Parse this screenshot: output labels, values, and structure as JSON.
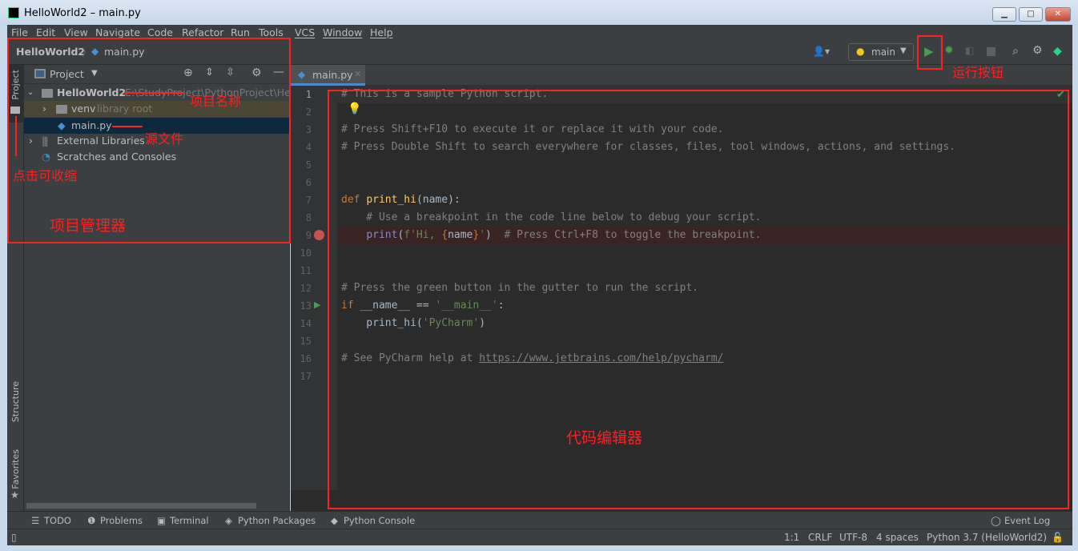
{
  "window": {
    "title": "HelloWorld2 – main.py",
    "min": "▁",
    "max": "□",
    "close": "✕"
  },
  "menu": [
    "File",
    "Edit",
    "View",
    "Navigate",
    "Code",
    "Refactor",
    "Run",
    "Tools",
    "VCS",
    "Window",
    "Help"
  ],
  "breadcrumb": {
    "project": "HelloWorld2",
    "file": "main.py"
  },
  "run_config": "main",
  "left_strip": {
    "project": "Project",
    "structure": "Structure",
    "favorites": "Favorites"
  },
  "project_panel": {
    "title": "Project",
    "tree": [
      {
        "label": "HelloWorld2",
        "hint": "E:\\StudyProject\\PythonProject\\Hello",
        "expanded": true,
        "bold": true
      },
      {
        "label": "venv",
        "hint": "library root"
      },
      {
        "label": "main.py",
        "selected": true
      },
      {
        "label": "External Libraries"
      },
      {
        "label": "Scratches and Consoles"
      }
    ]
  },
  "editor": {
    "tab": "main.py",
    "lines": [
      [
        {
          "t": "# This is a sample Python script.",
          "c": "#808080"
        }
      ],
      [],
      [
        {
          "t": "# Press Shift+F10 to execute it or replace it with your code.",
          "c": "#808080"
        }
      ],
      [
        {
          "t": "# Press Double Shift to search everywhere for classes, files, tool windows, actions, and settings.",
          "c": "#808080"
        }
      ],
      [],
      [],
      [
        {
          "t": "def ",
          "c": "#cc7832"
        },
        {
          "t": "print_hi",
          "c": "#ffc66d"
        },
        {
          "t": "(name):",
          "c": "#a9b7c6"
        }
      ],
      [
        {
          "t": "    # Use a breakpoint in the code line below to debug your script.",
          "c": "#808080"
        }
      ],
      [
        {
          "t": "    ",
          "c": "#a9b7c6"
        },
        {
          "t": "print",
          "c": "#8888c6"
        },
        {
          "t": "(",
          "c": "#a9b7c6"
        },
        {
          "t": "f'Hi, ",
          "c": "#6a8759"
        },
        {
          "t": "{",
          "c": "#cc7832"
        },
        {
          "t": "name",
          "c": "#a9b7c6"
        },
        {
          "t": "}",
          "c": "#cc7832"
        },
        {
          "t": "'",
          "c": "#6a8759"
        },
        {
          "t": ")  ",
          "c": "#a9b7c6"
        },
        {
          "t": "# Press Ctrl+F8 to toggle the breakpoint.",
          "c": "#808080"
        }
      ],
      [],
      [],
      [
        {
          "t": "# Press the green button in the gutter to run the script.",
          "c": "#808080"
        }
      ],
      [
        {
          "t": "if ",
          "c": "#cc7832"
        },
        {
          "t": "__name__ == ",
          "c": "#a9b7c6"
        },
        {
          "t": "'__main__'",
          "c": "#6a8759"
        },
        {
          "t": ":",
          "c": "#a9b7c6"
        }
      ],
      [
        {
          "t": "    print_hi(",
          "c": "#a9b7c6"
        },
        {
          "t": "'PyCharm'",
          "c": "#6a8759"
        },
        {
          "t": ")",
          "c": "#a9b7c6"
        }
      ],
      [],
      [
        {
          "t": "# See PyCharm help at ",
          "c": "#808080"
        },
        {
          "t": "https://www.jetbrains.com/help/pycharm/",
          "c": "#808080",
          "u": true
        }
      ],
      []
    ]
  },
  "tool_windows": [
    "TODO",
    "Problems",
    "Terminal",
    "Python Packages",
    "Python Console"
  ],
  "event_log": "Event Log",
  "status": {
    "position": "1:1",
    "line_sep": "CRLF",
    "encoding": "UTF-8",
    "indent": "4 spaces",
    "interpreter": "Python 3.7 (HelloWorld2)"
  },
  "annotations": {
    "project_name": "项目名称",
    "source_file": "源文件",
    "collapse": "点击可收缩",
    "project_manager": "项目管理器",
    "run_button": "运行按钮",
    "code_editor": "代码编辑器"
  },
  "colors": {
    "bg": "#2b2b2b",
    "panel": "#3c3f41",
    "selection": "#0d293e",
    "annotation": "#ff2020",
    "run": "#499c54"
  }
}
